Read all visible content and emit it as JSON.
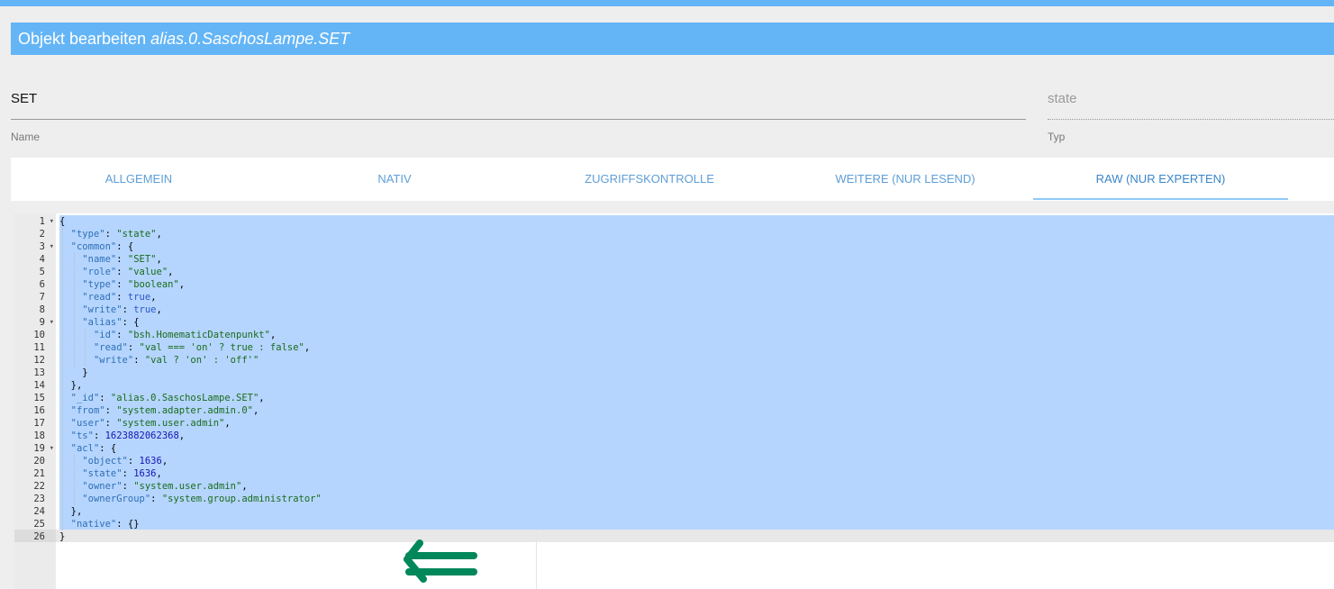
{
  "dialog": {
    "title_prefix": "Objekt bearbeiten",
    "object_id": "alias.0.SaschosLampe.SET"
  },
  "fields": {
    "name": {
      "value": "SET",
      "label": "Name"
    },
    "type": {
      "value": "state",
      "label": "Typ"
    }
  },
  "tabs": [
    {
      "label": "Allgemein",
      "active": false
    },
    {
      "label": "Nativ",
      "active": false
    },
    {
      "label": "Zugriffskontrolle",
      "active": false
    },
    {
      "label": "Weitere (nur lesend)",
      "active": false
    },
    {
      "label": "Raw (nur Experten)",
      "active": true
    }
  ],
  "editor": {
    "line_numbers": [
      "1",
      "2",
      "3",
      "4",
      "5",
      "6",
      "7",
      "8",
      "9",
      "10",
      "11",
      "12",
      "13",
      "14",
      "15",
      "16",
      "17",
      "18",
      "19",
      "20",
      "21",
      "22",
      "23",
      "24",
      "25",
      "26"
    ],
    "fold_lines": [
      1,
      3,
      9,
      19
    ],
    "lines": [
      "{",
      "  \"type\": \"state\",",
      "  \"common\": {",
      "    \"name\": \"SET\",",
      "    \"role\": \"value\",",
      "    \"type\": \"boolean\",",
      "    \"read\": true,",
      "    \"write\": true,",
      "    \"alias\": {",
      "      \"id\": \"bsh.HomematicDatenpunkt\",",
      "      \"read\": \"val === 'on' ? true : false\",",
      "      \"write\": \"val ? 'on' : 'off'\"",
      "    }",
      "  },",
      "  \"_id\": \"alias.0.SaschosLampe.SET\",",
      "  \"from\": \"system.adapter.admin.0\",",
      "  \"user\": \"system.user.admin\",",
      "  \"ts\": 1623882062368,",
      "  \"acl\": {",
      "    \"object\": 1636,",
      "    \"state\": 1636,",
      "    \"owner\": \"system.user.admin\",",
      "    \"ownerGroup\": \"system.group.administrator\"",
      "  },",
      "  \"native\": {}",
      "}"
    ]
  },
  "colors": {
    "accent": "#64b5f6",
    "selection": "#b5d5ff",
    "arrow": "#00875a"
  },
  "icons": {
    "fold": "chevron-down-icon",
    "annotation": "double-left-arrow-icon"
  }
}
